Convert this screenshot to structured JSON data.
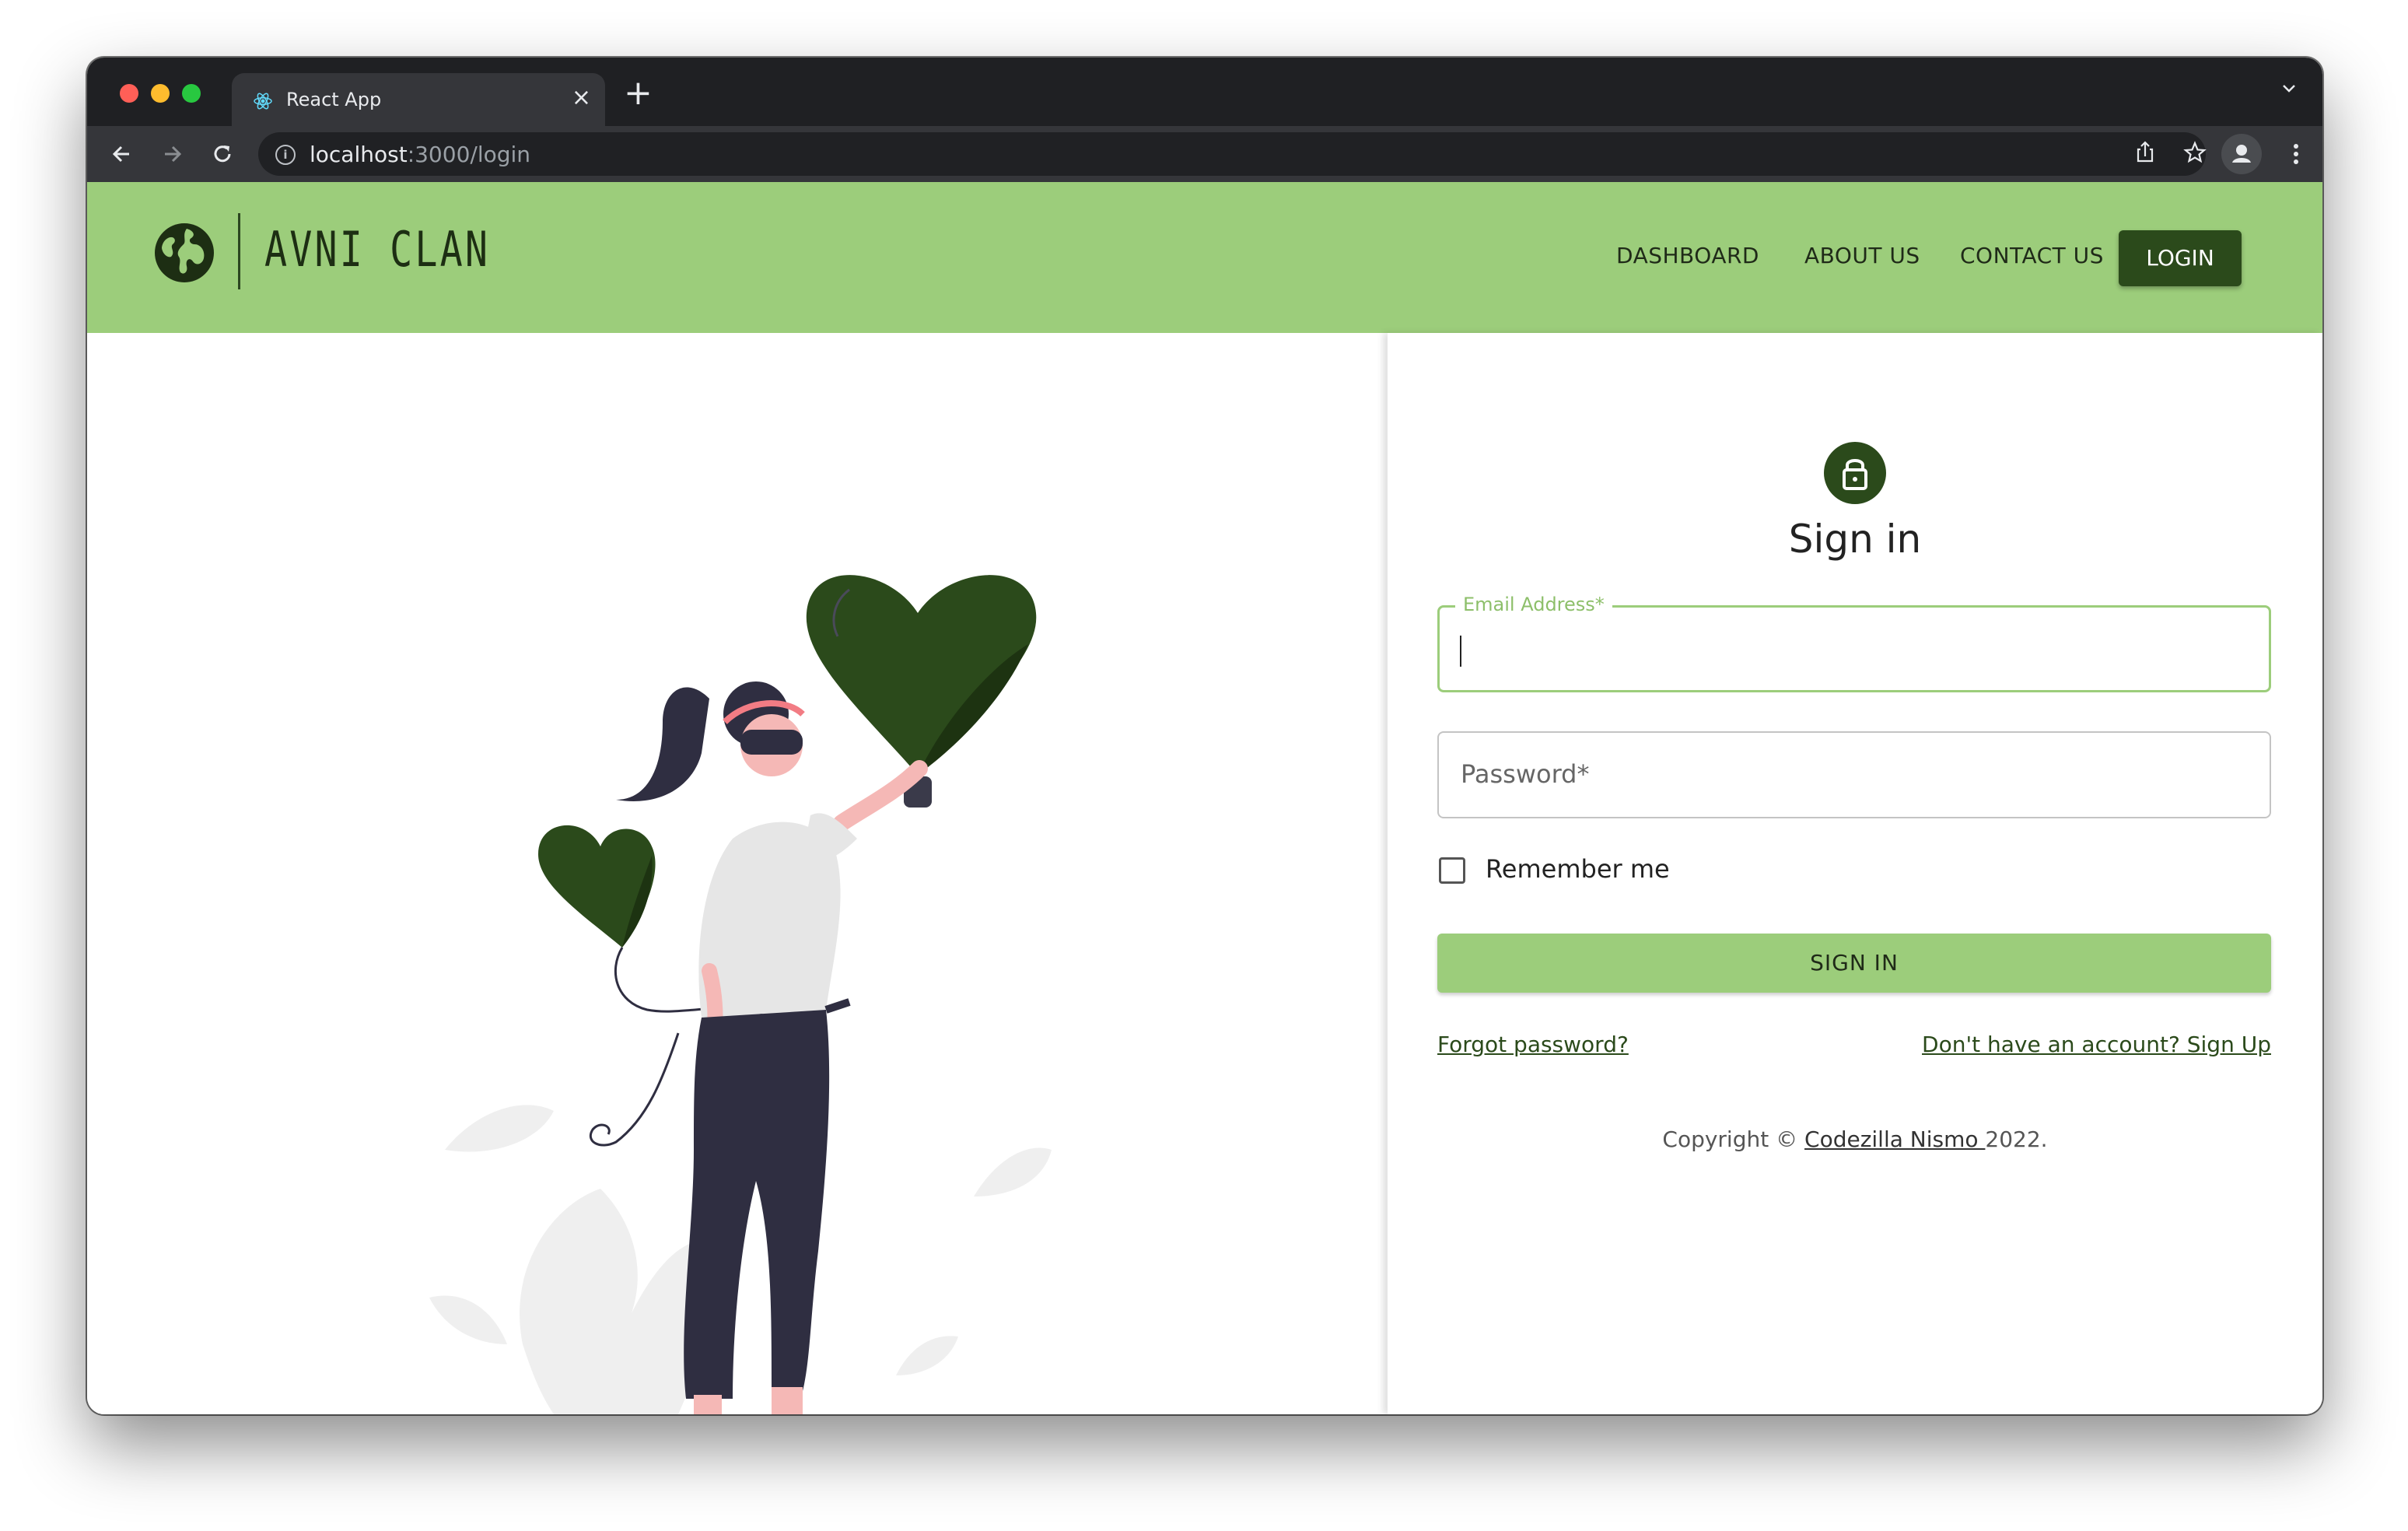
{
  "browser": {
    "tab_title": "React App",
    "tab_close": "×",
    "new_tab": "+",
    "url_host": "localhost",
    "url_path": ":3000/login"
  },
  "header": {
    "logo_text": "AVNI CLAN",
    "nav": [
      "DASHBOARD",
      "ABOUT US",
      "CONTACT US"
    ],
    "login_label": "LOGIN"
  },
  "form": {
    "title": "Sign in",
    "email_label": "Email Address",
    "email_value": "",
    "password_placeholder": "Password",
    "required_mark": "*",
    "remember_label": "Remember me",
    "remember_checked": false,
    "submit_label": "SIGN IN",
    "forgot_link": "Forgot password?",
    "signup_link": "Don't have an account? Sign Up"
  },
  "footer": {
    "copyright_prefix": "Copyright © ",
    "company": "Codezilla Nismo ",
    "year_suffix": "2022."
  },
  "colors": {
    "brand_green": "#9ccd7b",
    "dark_green": "#2b4a1b"
  },
  "icons": [
    "react-icon",
    "back-icon",
    "forward-icon",
    "reload-icon",
    "info-icon",
    "share-icon",
    "star-icon",
    "profile-icon",
    "menu-dots-icon",
    "globe-icon",
    "lock-icon"
  ]
}
